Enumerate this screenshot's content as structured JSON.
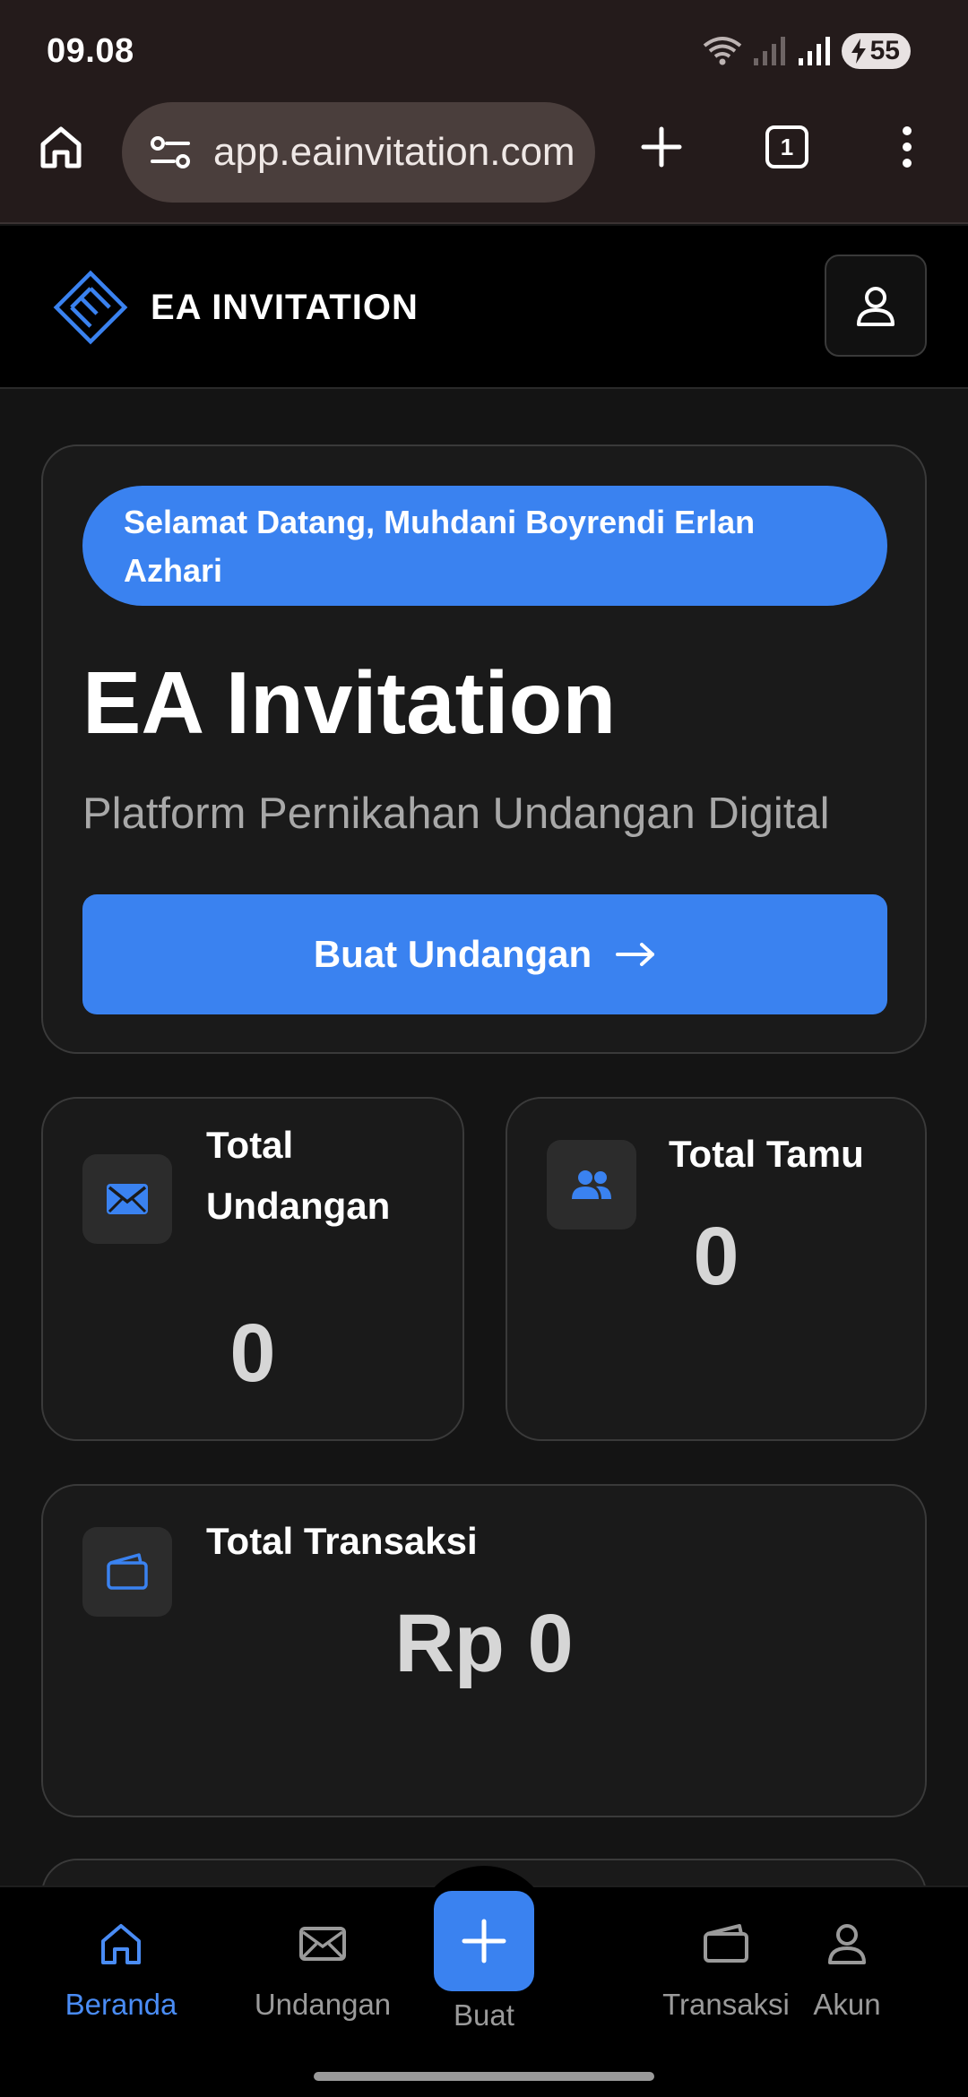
{
  "status_bar": {
    "time": "09.08",
    "battery": "55",
    "icons": [
      "wifi-icon",
      "signal-icon",
      "signal-icon",
      "battery-charging-icon"
    ]
  },
  "browser": {
    "url": "app.eainvitation.com",
    "tab_count": "1",
    "icons": [
      "home-icon",
      "site-settings-icon",
      "new-tab-icon",
      "tabs-icon",
      "more-vert-icon"
    ]
  },
  "header": {
    "brand": "EA INVITATION",
    "logo_icon": "ea-logo-icon",
    "profile_icon": "user-icon"
  },
  "hero": {
    "welcome": "Selamat Datang, Muhdani Boyrendi Erlan Azhari",
    "title": "EA Invitation",
    "subtitle": "Platform Pernikahan Undangan Digital",
    "cta_label": "Buat Undangan"
  },
  "stats": {
    "undangan": {
      "label_line1": "Total",
      "label_line2": "Undangan",
      "value": "0",
      "icon": "envelope-icon"
    },
    "tamu": {
      "label": "Total Tamu",
      "value": "0",
      "icon": "users-icon"
    },
    "transaksi": {
      "label": "Total Transaksi",
      "value": "Rp 0",
      "icon": "wallet-icon"
    }
  },
  "nav": {
    "items": [
      {
        "label": "Beranda",
        "icon": "home-icon",
        "active": true
      },
      {
        "label": "Undangan",
        "icon": "envelope-icon",
        "active": false
      },
      {
        "label": "Buat",
        "icon": "plus-icon",
        "active": false
      },
      {
        "label": "Transaksi",
        "icon": "wallet-icon",
        "active": false
      },
      {
        "label": "Akun",
        "icon": "user-icon",
        "active": false
      }
    ]
  },
  "colors": {
    "accent": "#3a82f0",
    "background": "#141414",
    "card": "#1a1a1a",
    "browser_chrome": "#241b1b"
  }
}
